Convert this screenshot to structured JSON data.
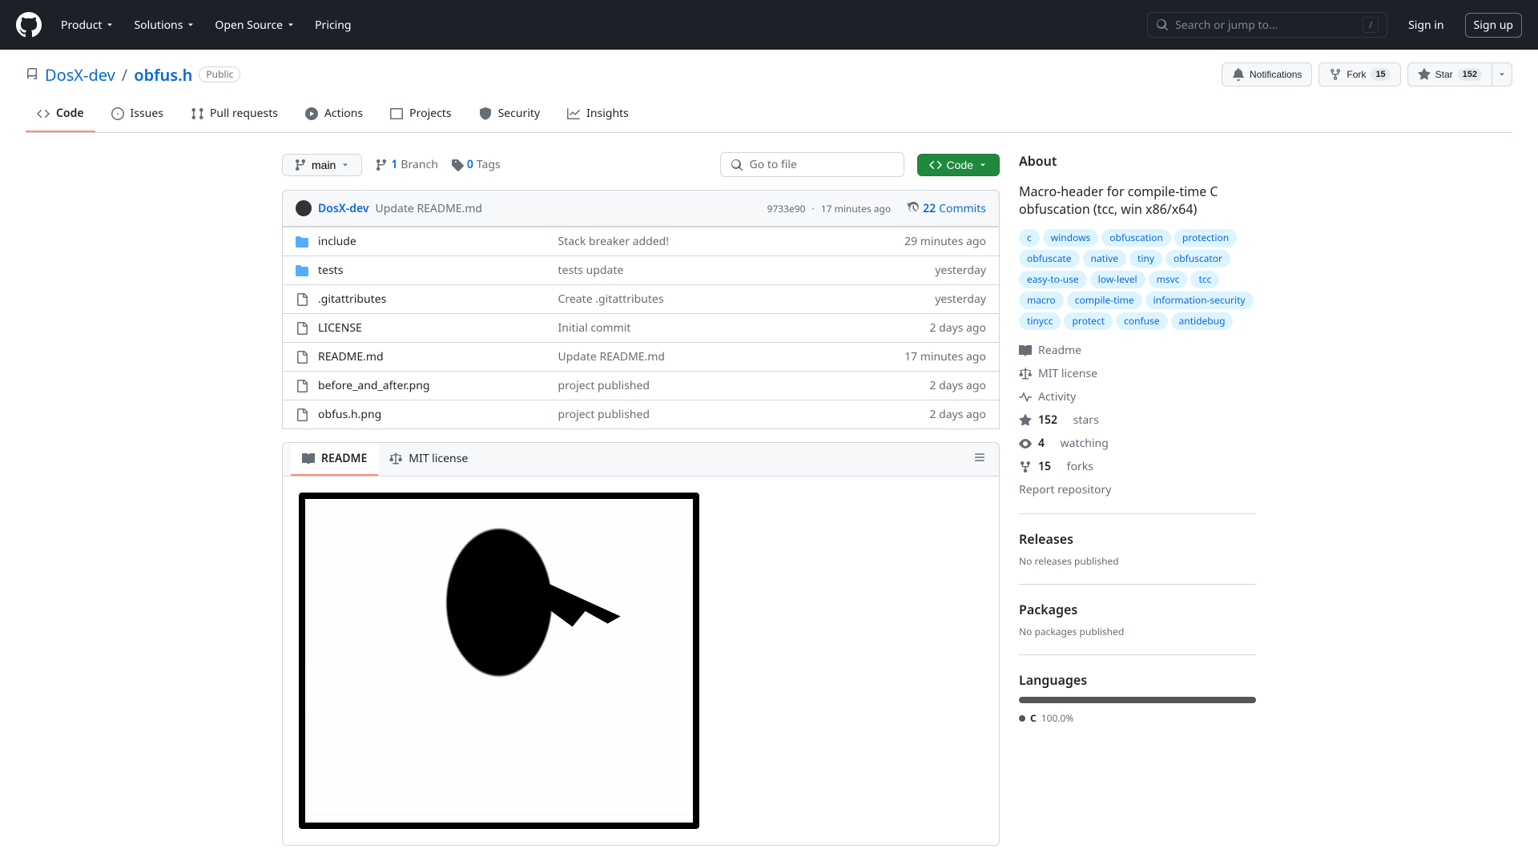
{
  "header": {
    "nav": [
      "Product",
      "Solutions",
      "Open Source",
      "Pricing"
    ],
    "search_placeholder": "Search or jump to...",
    "slash_key": "/",
    "sign_in": "Sign in",
    "sign_up": "Sign up"
  },
  "repo": {
    "owner": "DosX-dev",
    "name": "obfus.h",
    "visibility": "Public",
    "actions": {
      "notifications": "Notifications",
      "fork": "Fork",
      "fork_count": "15",
      "star": "Star",
      "star_count": "152"
    },
    "tabs": [
      "Code",
      "Issues",
      "Pull requests",
      "Actions",
      "Projects",
      "Security",
      "Insights"
    ],
    "selected_tab": 0
  },
  "branch_bar": {
    "branch": "main",
    "branches_count": "1",
    "branches_label": "Branch",
    "tags_count": "0",
    "tags_label": "Tags",
    "goto_placeholder": "Go to file",
    "code_btn": "Code"
  },
  "latest_commit": {
    "author": "DosX-dev",
    "message": "Update README.md",
    "sha": "9733e90",
    "dot": "·",
    "ago": "17 minutes ago",
    "commits_count": "22",
    "commits_label": "Commits"
  },
  "files": [
    {
      "type": "dir",
      "name": "include",
      "msg": "Stack breaker added!",
      "time": "29 minutes ago"
    },
    {
      "type": "dir",
      "name": "tests",
      "msg": "tests update",
      "time": "yesterday"
    },
    {
      "type": "file",
      "name": ".gitattributes",
      "msg": "Create .gitattributes",
      "time": "yesterday"
    },
    {
      "type": "file",
      "name": "LICENSE",
      "msg": "Initial commit",
      "time": "2 days ago"
    },
    {
      "type": "file",
      "name": "README.md",
      "msg": "Update README.md",
      "time": "17 minutes ago"
    },
    {
      "type": "file",
      "name": "before_and_after.png",
      "msg": "project published",
      "time": "2 days ago"
    },
    {
      "type": "file",
      "name": "obfus.h.png",
      "msg": "project published",
      "time": "2 days ago"
    }
  ],
  "readme": {
    "tabs": [
      "README",
      "MIT license"
    ],
    "selected": 0
  },
  "sidebar": {
    "about_heading": "About",
    "description": "Macro-header for compile-time C obfuscation (tcc, win x86/x64)",
    "topics": [
      "c",
      "windows",
      "obfuscation",
      "protection",
      "obfuscate",
      "native",
      "tiny",
      "obfuscator",
      "easy-to-use",
      "low-level",
      "msvc",
      "tcc",
      "macro",
      "compile-time",
      "information-security",
      "tinycc",
      "protect",
      "confuse",
      "antidebug"
    ],
    "links": {
      "readme": "Readme",
      "license": "MIT license",
      "activity": "Activity",
      "stars_count": "152",
      "stars_label": "stars",
      "watching_count": "4",
      "watching_label": "watching",
      "forks_count": "15",
      "forks_label": "forks",
      "report": "Report repository"
    },
    "releases": {
      "heading": "Releases",
      "text": "No releases published"
    },
    "packages": {
      "heading": "Packages",
      "text": "No packages published"
    },
    "languages": {
      "heading": "Languages",
      "lang": "C",
      "pct": "100.0%"
    }
  }
}
